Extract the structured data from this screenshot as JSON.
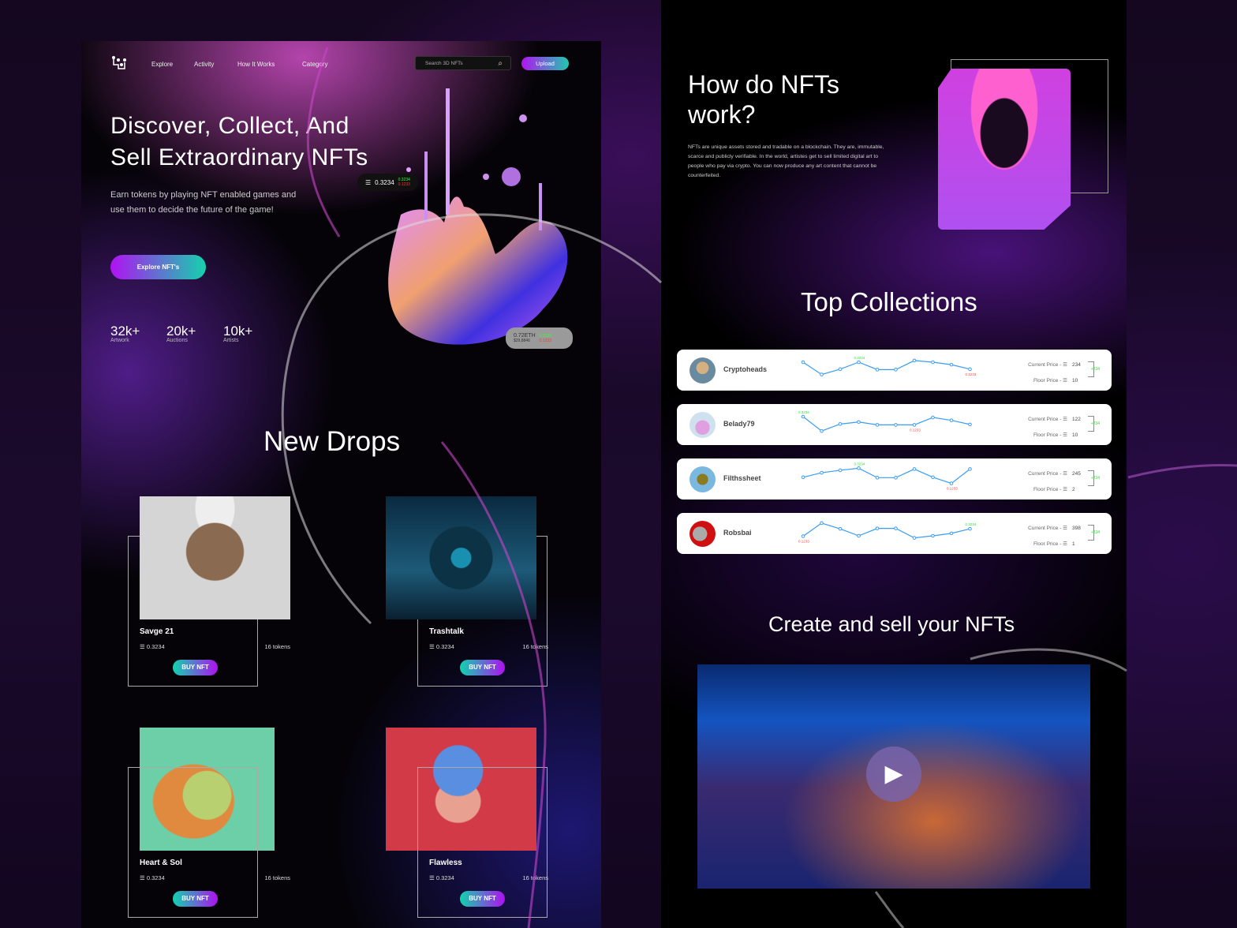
{
  "nav": {
    "items": [
      "Explore",
      "Activity",
      "How It Works",
      "Category"
    ],
    "search_placeholder": "Search 3D NFTs",
    "upload": "Upload"
  },
  "hero": {
    "title_line1": "Discover, Collect, And",
    "title_line2": "Sell Extraordinary NFTs",
    "subtitle": "Earn tokens by playing NFT enabled games and use them to decide the future of the game!",
    "cta": "Explore NFT's",
    "stats": [
      {
        "value": "32k+",
        "label": "Artwork"
      },
      {
        "value": "20k+",
        "label": "Auctions"
      },
      {
        "value": "10k+",
        "label": "Artists"
      }
    ],
    "price_pill": {
      "value": "0.3234",
      "up": "0.3234",
      "down": "0.1233"
    },
    "eth_pill": {
      "value": "0.72ETH",
      "usd": "$29,8846",
      "up": "0.3234",
      "down": "0.1233"
    }
  },
  "new_drops": {
    "title": "New Drops",
    "buy_label": "BUY NFT",
    "items": [
      {
        "name": "Savge 21",
        "price": "0.3234",
        "tokens": "16 tokens"
      },
      {
        "name": "Trashtalk",
        "price": "0.3234",
        "tokens": "16 tokens"
      },
      {
        "name": "Heart & Sol",
        "price": "0.3234",
        "tokens": "16 tokens"
      },
      {
        "name": "Flawless",
        "price": "0.3234",
        "tokens": "16 tokens"
      }
    ]
  },
  "how": {
    "title": "How do NFTs work?",
    "body": "NFTs are unique assets stored and tradable on a blockchain. They are, immutable, scarce and publicly verifiable. In the world, artistes get to sell limited digital art to  people who pay via crypto. You can now produce any art content that cannot be counterfeited."
  },
  "top": {
    "title": "Top Collections",
    "current_label": "Current Price -",
    "floor_label": "Floor Price -",
    "items": [
      {
        "name": "Cryptoheads",
        "current": "234",
        "floor": "10",
        "delta": "+234",
        "trend": [
          5,
          2,
          3.3,
          5,
          3.2,
          3.2,
          5.4,
          5,
          4.4,
          3.3
        ],
        "high_label": "0.3234",
        "high_idx": 3,
        "low_label": "0.1233",
        "low_idx": 9
      },
      {
        "name": "Belady79",
        "current": "122",
        "floor": "10",
        "delta": "+234",
        "trend": [
          5,
          1.5,
          3.2,
          3.7,
          3,
          3,
          3,
          4.8,
          4.1,
          3.1
        ],
        "high_label": "0.3234",
        "high_idx": 0,
        "low_label": "0.1233",
        "low_idx": 6
      },
      {
        "name": "Filthssheet",
        "current": "245",
        "floor": "2",
        "delta": "+234",
        "trend": [
          3.5,
          4.6,
          5.2,
          5.7,
          3.4,
          3.4,
          5.5,
          3.5,
          2,
          5.5
        ],
        "high_label": "0.3234",
        "high_idx": 3,
        "low_label": "0.1233",
        "low_idx": 8
      },
      {
        "name": "Robsbai",
        "current": "398",
        "floor": "1",
        "delta": "+234",
        "trend": [
          2.4,
          5.6,
          4.2,
          2.5,
          4.3,
          4.3,
          2,
          2.5,
          3.1,
          4.2
        ],
        "high_label": "0.3234",
        "high_idx": 9,
        "low_label": "0.1233",
        "low_idx": 0
      }
    ]
  },
  "create": {
    "title": "Create and sell your NFTs"
  },
  "colors": {
    "accent_purple": "#b012f2",
    "accent_teal": "#14d2ae",
    "line_blue": "#3a9cf5"
  }
}
